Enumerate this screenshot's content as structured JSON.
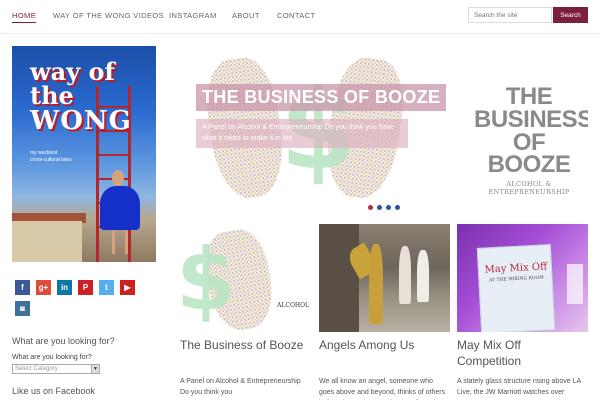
{
  "nav": {
    "items": [
      {
        "label": "HOME",
        "active": true
      },
      {
        "label": "WAY OF THE WONG VIDEOS",
        "active": false
      },
      {
        "label": "INSTAGRAM",
        "active": false
      },
      {
        "label": "ABOUT",
        "active": false
      },
      {
        "label": "CONTACT",
        "active": false
      }
    ],
    "search_placeholder": "Search the site",
    "search_button": "Search"
  },
  "sidebar": {
    "book": {
      "title_top": "way of the",
      "title_main": "WONG",
      "subtitle": "my wackiest\ncross-cultural tales"
    },
    "social": [
      {
        "name": "facebook-icon",
        "glyph": "f",
        "color": "#3b5998"
      },
      {
        "name": "google-plus-icon",
        "glyph": "g+",
        "color": "#dd4b39"
      },
      {
        "name": "linkedin-icon",
        "glyph": "in",
        "color": "#0e76a8"
      },
      {
        "name": "pinterest-icon",
        "glyph": "P",
        "color": "#cb2027"
      },
      {
        "name": "twitter-icon",
        "glyph": "t",
        "color": "#55acee"
      },
      {
        "name": "youtube-icon",
        "glyph": "▶",
        "color": "#cd201f"
      },
      {
        "name": "instagram-icon",
        "glyph": "◙",
        "color": "#3f729b"
      }
    ],
    "search_heading": "What are you looking for?",
    "search_label": "What are you looking for?",
    "category_select": "Select Category",
    "facebook_heading": "Like us on Facebook"
  },
  "slider": {
    "title": "THE BUSINESS OF BOOZE",
    "description": "A Panel on Alcohol & Entrepreneurship Do you think you have what it takes to make it in the",
    "brand_lines": [
      "THE",
      "BUSINESS",
      "OF BOOZE"
    ],
    "brand_sub": "ALCOHOL & ENTREPRENEURSHIP",
    "dot_count": 4,
    "active_dot": 0
  },
  "cards": [
    {
      "title": "The Business of Booze",
      "excerpt": "A Panel on Alcohol & Entrepreneurship Do you think you",
      "image_caption": "ALCOHOL"
    },
    {
      "title": "Angels Among Us",
      "excerpt": "We all know an angel, someone who goes above and beyond, thinks of others before themselves, and generally makes the rest of us look",
      "image_caption": ""
    },
    {
      "title": "May Mix Off Competition",
      "excerpt": "A stately glass structure rising above LA Live, the JW Marriott watches over",
      "image_caption": "May Mix Off",
      "image_caption_sub": "AT THE MIXING ROOM"
    }
  ],
  "colors": {
    "accent": "#7b1f3c",
    "nav_text": "#666666"
  }
}
